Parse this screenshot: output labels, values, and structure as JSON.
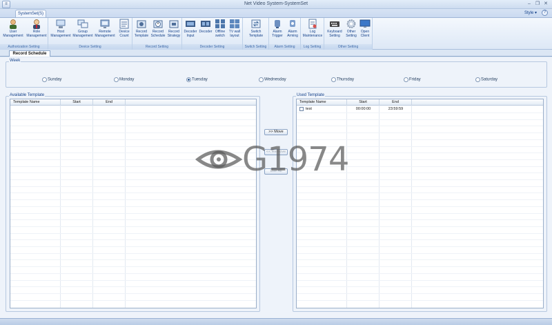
{
  "window": {
    "title": "Net Video System-SystemSet",
    "minimize": "–",
    "restore": "❐",
    "close": "✕"
  },
  "app_menu_glyph": "≡",
  "ribbon_tab": "SystemSet(S)",
  "style_menu": "Style",
  "style_chevron": "▾",
  "help_glyph": "?",
  "ribbon_groups": [
    {
      "label": "Authorization Setting",
      "buttons": [
        "User\nManagement",
        "Role\nManagement"
      ]
    },
    {
      "label": "Device Setting",
      "buttons": [
        "Host\nManagement",
        "Group\nManagement",
        "Remote\nManagement",
        "Device\nCount"
      ]
    },
    {
      "label": "Record Setting",
      "buttons": [
        "Record\nTemplate",
        "Record\nSchedule",
        "Record\nStrategy"
      ]
    },
    {
      "label": "Decoder Setting",
      "buttons": [
        "Decoder\nInput",
        "Decoder",
        "Offline\nswitch",
        "TV wall\nlayout"
      ]
    },
    {
      "label": "Switch Setting",
      "buttons": [
        "Switch\nTemplate"
      ]
    },
    {
      "label": "Alarm Setting",
      "buttons": [
        "Alarm\nTrigger",
        "Alarm\nArming"
      ]
    },
    {
      "label": "Log Setting",
      "buttons": [
        "Log\nMaintenance"
      ]
    },
    {
      "label": "Other Setting",
      "buttons": [
        "Keyboard\nSetting",
        "Other\nSetting",
        "Open\nClient"
      ]
    }
  ],
  "icons": {
    "user": "user-icon",
    "role": "role-icon",
    "host": "host-icon",
    "group": "group-icon",
    "remote": "remote-icon",
    "count": "count-icon",
    "rec_template": "record-template-icon",
    "rec_schedule": "record-schedule-icon",
    "rec_strategy": "record-strategy-icon",
    "dec_input": "decoder-input-icon",
    "decoder": "decoder-icon",
    "offline": "offline-switch-icon",
    "tvwall": "tv-wall-icon",
    "switch": "switch-template-icon",
    "alarm_trigger": "alarm-trigger-icon",
    "alarm_arming": "alarm-arming-icon",
    "log": "log-icon",
    "keyboard": "keyboard-icon",
    "other": "gear-icon",
    "client": "monitor-icon"
  },
  "page_tab": "Record Schedule",
  "week": {
    "legend": "Week",
    "days": [
      "Sunday",
      "Monday",
      "Tuesday",
      "Wednesday",
      "Thursday",
      "Friday",
      "Saturday"
    ],
    "selected": "Tuesday"
  },
  "available": {
    "legend": "Available Template",
    "columns": [
      "Template Name",
      "Start",
      "End"
    ],
    "rows": []
  },
  "used": {
    "legend": "Used Template",
    "columns": [
      "Template Name",
      "Start",
      "End"
    ],
    "rows": [
      {
        "checked": false,
        "name": "test",
        "start": "00:00:00",
        "end": "23:59:59"
      }
    ]
  },
  "buttons": {
    "move": ">> Move",
    "remove": "<< Remove",
    "use_all": "Use All"
  },
  "watermark": "G1974"
}
